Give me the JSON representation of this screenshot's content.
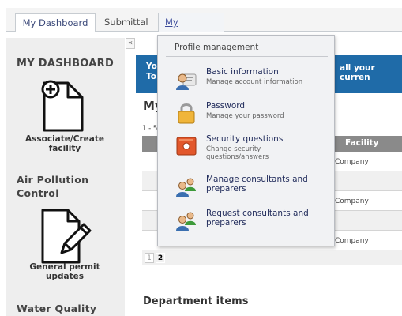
{
  "tabs": {
    "dashboard": "My Dashboard",
    "submittal": "Submittal",
    "account": "My Account"
  },
  "sidebar": {
    "collapse_label": "«",
    "heading": "MY DASHBOARD",
    "associate_label": "Associate/Create facility",
    "air_heading": "Air Pollution Control",
    "permit_label": "General permit updates",
    "water_heading": "Water Quality"
  },
  "banner": {
    "left_text_1": "Yo",
    "left_text_2": "To",
    "right_text": "all your curren"
  },
  "main": {
    "title": "My",
    "pager_top": "1 - 5",
    "facility_header": "Facility",
    "company_rows": [
      "Company",
      "Company",
      "Company"
    ],
    "page_1": "1",
    "page_2": "2",
    "department_title": "Department items"
  },
  "dropdown": {
    "title": "Profile management",
    "items": [
      {
        "label": "Basic information",
        "sub": "Manage account information",
        "icon": "user-card-icon"
      },
      {
        "label": "Password",
        "sub": "Manage your password",
        "icon": "padlock-icon"
      },
      {
        "label": "Security questions",
        "sub": "Change security questions/answers",
        "icon": "safe-icon"
      },
      {
        "label": "Manage consultants and preparers",
        "sub": "",
        "icon": "users-icon"
      },
      {
        "label": "Request consultants and preparers",
        "sub": "",
        "icon": "users-add-icon"
      }
    ]
  },
  "colors": {
    "banner": "#1f6ba8",
    "sidebar": "#eeeeee",
    "table_header": "#8a8a8a",
    "dropdown_bg": "#f1f2f4"
  }
}
